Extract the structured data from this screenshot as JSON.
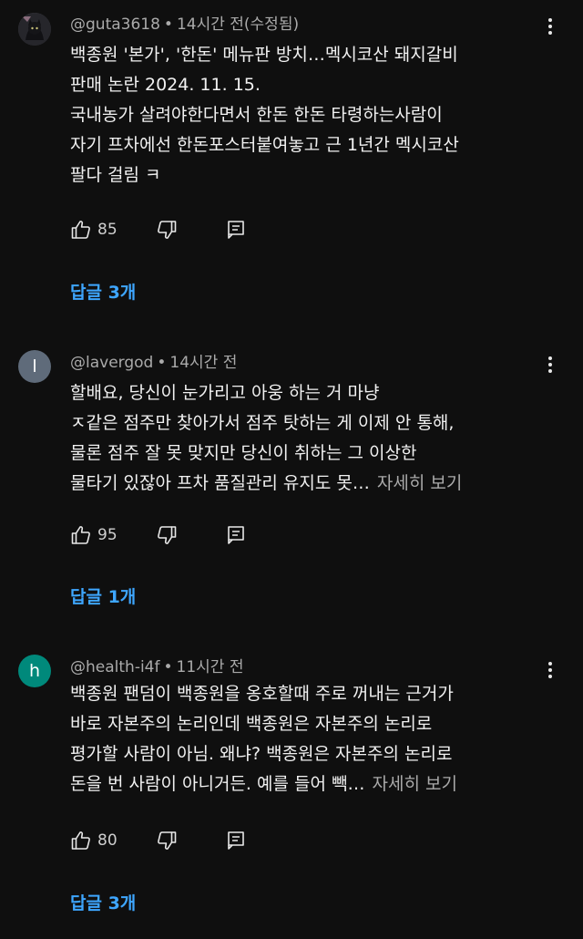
{
  "comments": [
    {
      "avatar_type": "photo",
      "avatar_letter": "",
      "avatar_color": "#2a2a2e",
      "author": "@guta3618",
      "separator": "•",
      "time": "14시간 전(수정됨)",
      "lines": [
        "백종원 '본가', '한돈' 메뉴판 방치…멕시코산 돼지갈비",
        "판매 논란 2024. 11. 15.",
        "국내농가 살려야한다면서 한돈 한돈 타령하는사람이",
        "자기 프차에선 한돈포스터붙여놓고 근 1년간 멕시코산",
        "팔다 걸림 ㅋ"
      ],
      "read_more": "",
      "likes": "85",
      "replies": "답글 3개"
    },
    {
      "avatar_type": "letter",
      "avatar_letter": "l",
      "avatar_color": "#5f6b7a",
      "author": "@lavergod",
      "separator": "•",
      "time": "14시간 전",
      "lines": [
        "할배요, 당신이 눈가리고 아웅 하는 거 마냥",
        "ㅈ같은 점주만 찾아가서 점주 탓하는 게 이제 안 통해,",
        "물론 점주 잘 못 맞지만 당신이 취하는 그 이상한",
        "물타기 있잖아 프차 품질관리 유지도 못…"
      ],
      "read_more": "자세히 보기",
      "likes": "95",
      "replies": "답글 1개"
    },
    {
      "avatar_type": "letter",
      "avatar_letter": "h",
      "avatar_color": "#00897b",
      "author": "@health-i4f",
      "separator": "•",
      "time": "11시간 전",
      "lines": [
        "백종원 팬덤이 백종원을 옹호할때 주로 꺼내는 근거가",
        "바로 자본주의 논리인데 백종원은 자본주의 논리로",
        "평가할 사람이 아님. 왜냐? 백종원은 자본주의 논리로",
        "돈을 번 사람이 아니거든. 예를 들어 빽…"
      ],
      "read_more": "자세히 보기",
      "likes": "80",
      "replies": "답글 3개"
    }
  ],
  "icons": {
    "like": "thumbs-up-icon",
    "dislike": "thumbs-down-icon",
    "reply": "reply-comment-icon",
    "more": "more-vertical-icon"
  },
  "colors": {
    "background": "#0f0f0f",
    "text": "#f1f1f1",
    "meta": "#aaaaaa",
    "link": "#3ea6ff"
  }
}
